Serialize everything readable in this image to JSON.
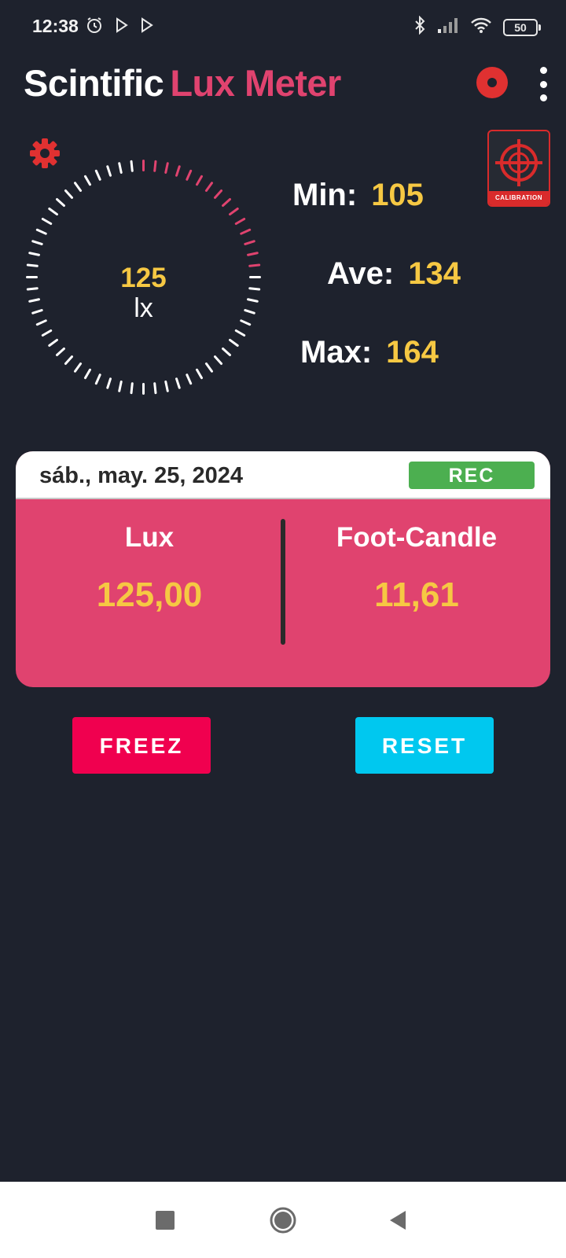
{
  "status_bar": {
    "time": "12:38",
    "battery": "50",
    "icons": [
      "alarm-icon",
      "play-store-icon",
      "play-store-icon",
      "bluetooth-icon",
      "signal-icon",
      "wifi-icon",
      "battery-icon"
    ]
  },
  "app_bar": {
    "title_part1": "Scintific",
    "title_part2": "Lux Meter",
    "actions": [
      "record-icon",
      "more-vert-icon"
    ]
  },
  "gauge": {
    "value": "125",
    "unit": "lx",
    "level": 0.25
  },
  "calibration": {
    "label": "CALIBRATION"
  },
  "stats": {
    "min_label": "Min:",
    "min_value": "105",
    "ave_label": "Ave:",
    "ave_value": "134",
    "max_label": "Max:",
    "max_value": "164"
  },
  "card": {
    "date": "sáb., may. 25, 2024",
    "rec_label": "REC",
    "lux_label": "Lux",
    "lux_value": "125,00",
    "fc_label": "Foot-Candle",
    "fc_value": "11,61"
  },
  "buttons": {
    "freez": "FREEZ",
    "reset": "RESET"
  },
  "colors": {
    "background": "#1e222d",
    "accent_pink": "#e0436f",
    "value_yellow": "#f6c843",
    "freez": "#f0004f",
    "reset": "#00c8ef",
    "rec": "#4caf50",
    "red_icon": "#e03131"
  }
}
